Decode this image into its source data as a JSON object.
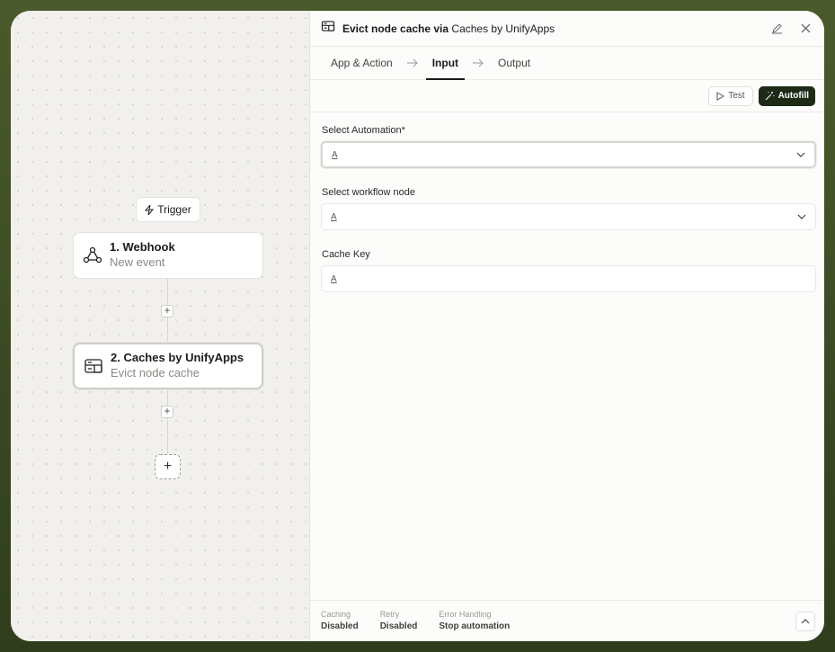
{
  "canvas": {
    "trigger_label": "Trigger",
    "nodes": [
      {
        "title": "1. Webhook",
        "subtitle": "New event",
        "icon": "webhook-icon"
      },
      {
        "title": "2. Caches by UnifyApps",
        "subtitle": "Evict node cache",
        "icon": "cache-icon"
      }
    ]
  },
  "panel": {
    "title_prefix": "Evict node cache via",
    "title_app": "Caches by UnifyApps",
    "tabs": [
      {
        "label": "App & Action"
      },
      {
        "label": "Input"
      },
      {
        "label": "Output"
      }
    ],
    "toolbar": {
      "test_label": "Test",
      "autofill_label": "Autofill"
    },
    "fields": [
      {
        "label": "Select Automation*",
        "type_icon": "A"
      },
      {
        "label": "Select workflow node",
        "type_icon": "A"
      },
      {
        "label": "Cache Key",
        "type_icon": "A"
      }
    ],
    "footer": {
      "items": [
        {
          "key": "Caching",
          "value": "Disabled"
        },
        {
          "key": "Retry",
          "value": "Disabled"
        },
        {
          "key": "Error Handling",
          "value": "Stop automation"
        }
      ]
    }
  },
  "colors": {
    "accent": "#1d2a16",
    "frame_bg": "#3b4a24"
  }
}
